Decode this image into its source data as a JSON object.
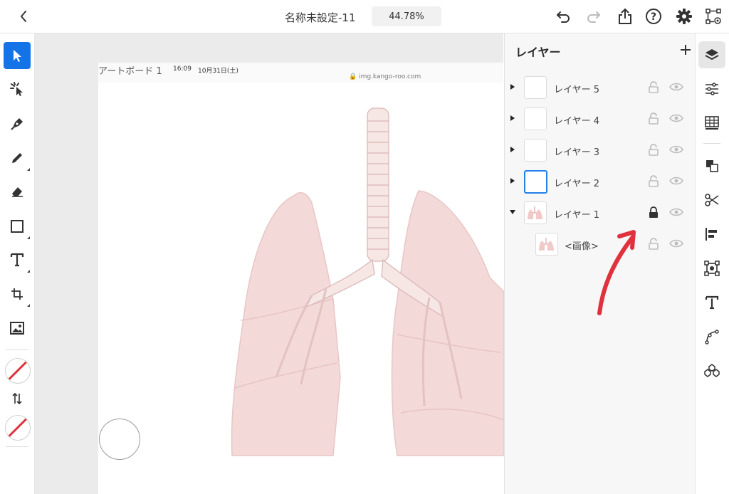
{
  "header": {
    "doc_title": "名称未設定-11",
    "zoom": "44.78%",
    "icons": [
      "back-chevron-icon",
      "undo-icon",
      "redo-icon",
      "share-icon",
      "help-icon",
      "settings-gear-icon",
      "prototype-icon"
    ]
  },
  "left_toolbar": {
    "tools": [
      "select-icon",
      "smart-select-icon",
      "pen-icon",
      "pencil-icon",
      "eraser-icon",
      "rectangle-icon",
      "text-icon",
      "place-shape-icon",
      "image-icon"
    ],
    "fill_color": "none",
    "stroke_color": "none"
  },
  "artboard": {
    "label": "アートボード 1",
    "status_time": "16:09",
    "status_date": "10月31日(土)",
    "url": "🔒 img.kango-roo.com"
  },
  "layers_panel": {
    "title": "レイヤー",
    "add_symbol": "+",
    "layers": [
      {
        "name": "レイヤー 5",
        "expanded": false,
        "locked": false,
        "visible": true,
        "selected": false
      },
      {
        "name": "レイヤー 4",
        "expanded": false,
        "locked": false,
        "visible": true,
        "selected": false
      },
      {
        "name": "レイヤー 3",
        "expanded": false,
        "locked": false,
        "visible": true,
        "selected": false
      },
      {
        "name": "レイヤー 2",
        "expanded": false,
        "locked": false,
        "visible": true,
        "selected": true
      },
      {
        "name": "レイヤー 1",
        "expanded": true,
        "locked": true,
        "visible": true,
        "selected": false
      }
    ],
    "child": {
      "name": "<画像>",
      "locked": false,
      "visible": true
    }
  },
  "right_rail": {
    "tools": [
      "layers-icon",
      "properties-icon",
      "grid-icon",
      "arrange-icon",
      "path-ops-icon",
      "align-icon",
      "transform-icon",
      "type-icon",
      "repeat-path-icon",
      "repeat-grid-icon"
    ]
  },
  "colors": {
    "accent": "#1473e6",
    "selected_border": "#2680eb",
    "annotation_arrow": "#e0323c",
    "lung_fill": "#f4d7d7"
  }
}
